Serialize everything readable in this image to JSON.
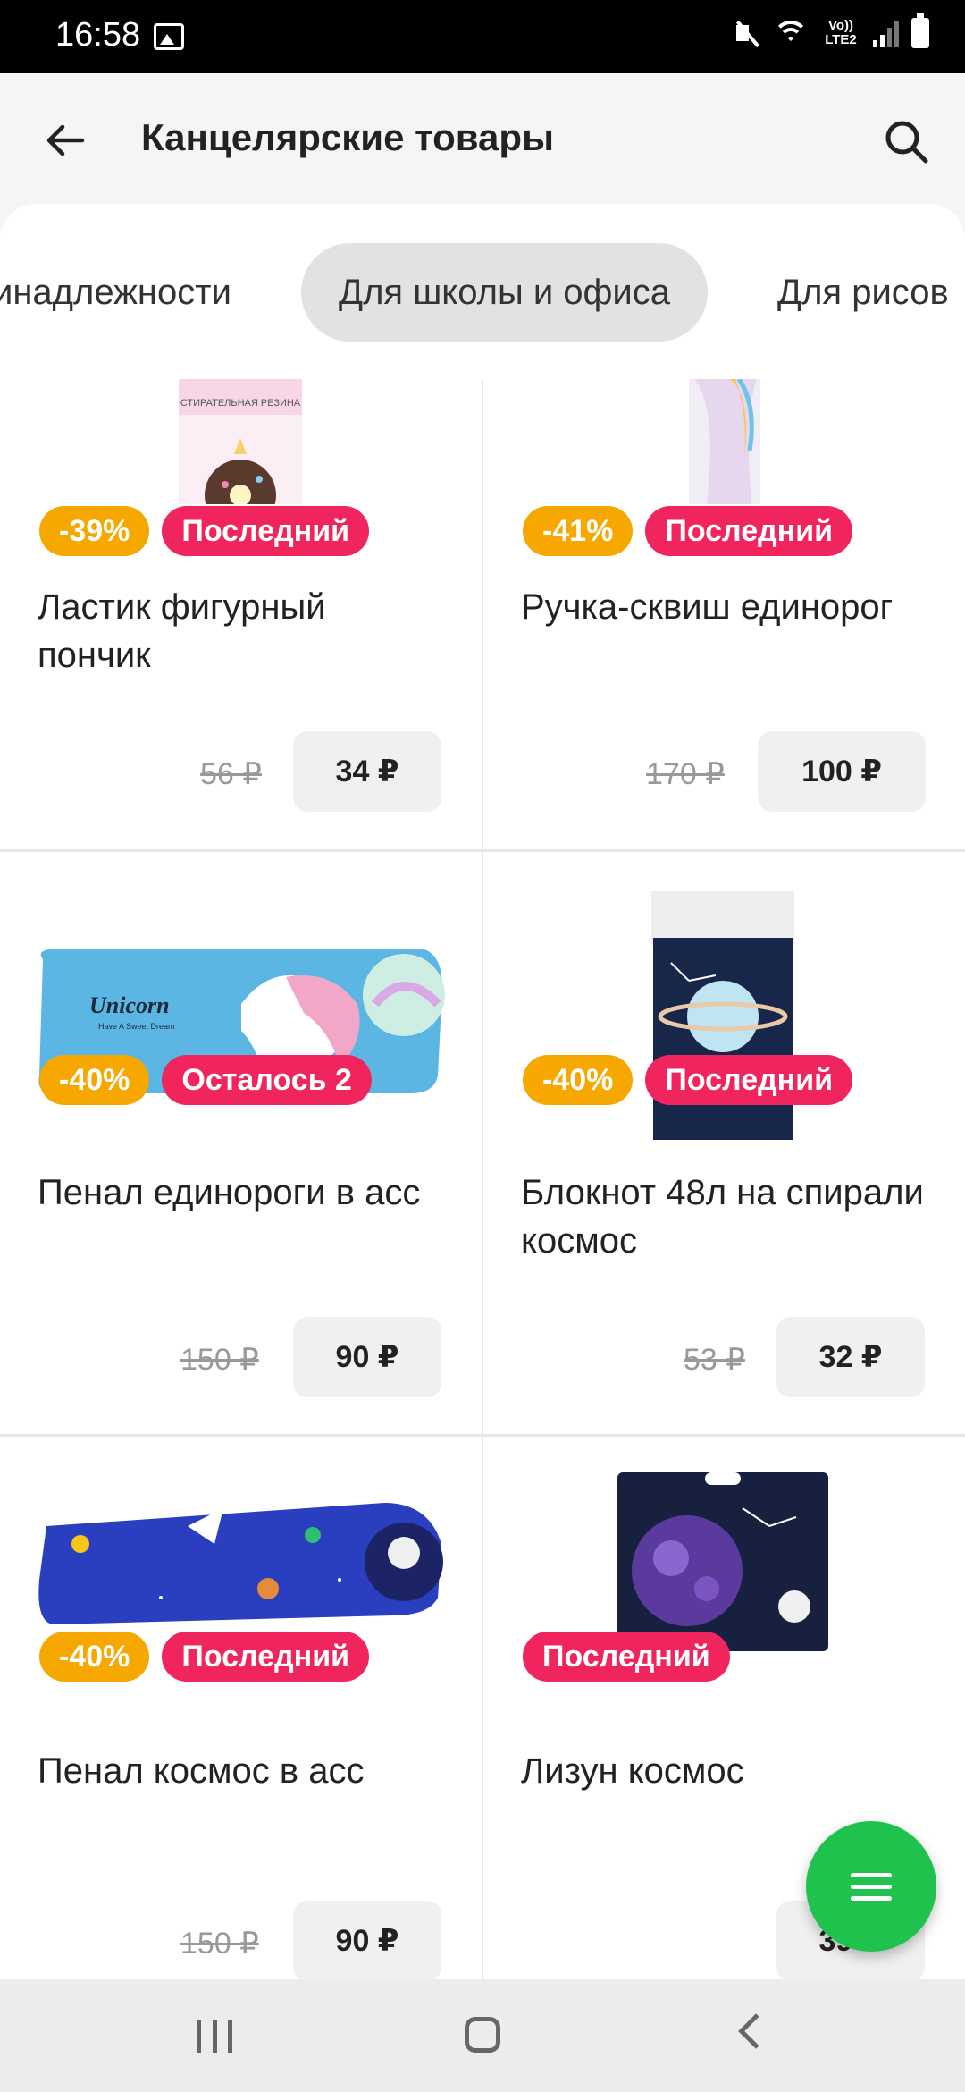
{
  "status": {
    "time": "16:58",
    "network": "Vo)) LTE2"
  },
  "header": {
    "title": "Канцелярские товары"
  },
  "tabs": [
    "инадлежности",
    "Для школы и офиса",
    "Для рисов"
  ],
  "products": [
    {
      "discount": "-39%",
      "stock": "Последний",
      "title": "Ластик фигурный пончик",
      "old_price": "56 ₽",
      "price": "34 ₽"
    },
    {
      "discount": "-41%",
      "stock": "Последний",
      "title": "Ручка-сквиш единорог",
      "old_price": "170 ₽",
      "price": "100 ₽"
    },
    {
      "discount": "-40%",
      "stock": "Осталось 2",
      "title": "Пенал единороги в асс",
      "old_price": "150 ₽",
      "price": "90 ₽"
    },
    {
      "discount": "-40%",
      "stock": "Последний",
      "title": "Блокнот 48л на спирали космос",
      "old_price": "53 ₽",
      "price": "32 ₽"
    },
    {
      "discount": "-40%",
      "stock": "Последний",
      "title": "Пенал космос в асс",
      "old_price": "150 ₽",
      "price": "90 ₽"
    },
    {
      "discount": "",
      "stock": "Последний",
      "title": "Лизун космос",
      "old_price": "",
      "price": "39 ₽"
    }
  ],
  "image_text": {
    "eraser_pack": "СТИРАТЕЛЬНАЯ РЕЗИНА",
    "pencil_case": "Unicorn",
    "pencil_case_sub": "Have A Sweet Dream"
  },
  "colors": {
    "discount": "#f6a800",
    "stock": "#f0255d",
    "fab": "#1fc24d"
  },
  "icons": {
    "back": "arrow-left-icon",
    "search": "search-icon",
    "fab": "menu-icon"
  }
}
